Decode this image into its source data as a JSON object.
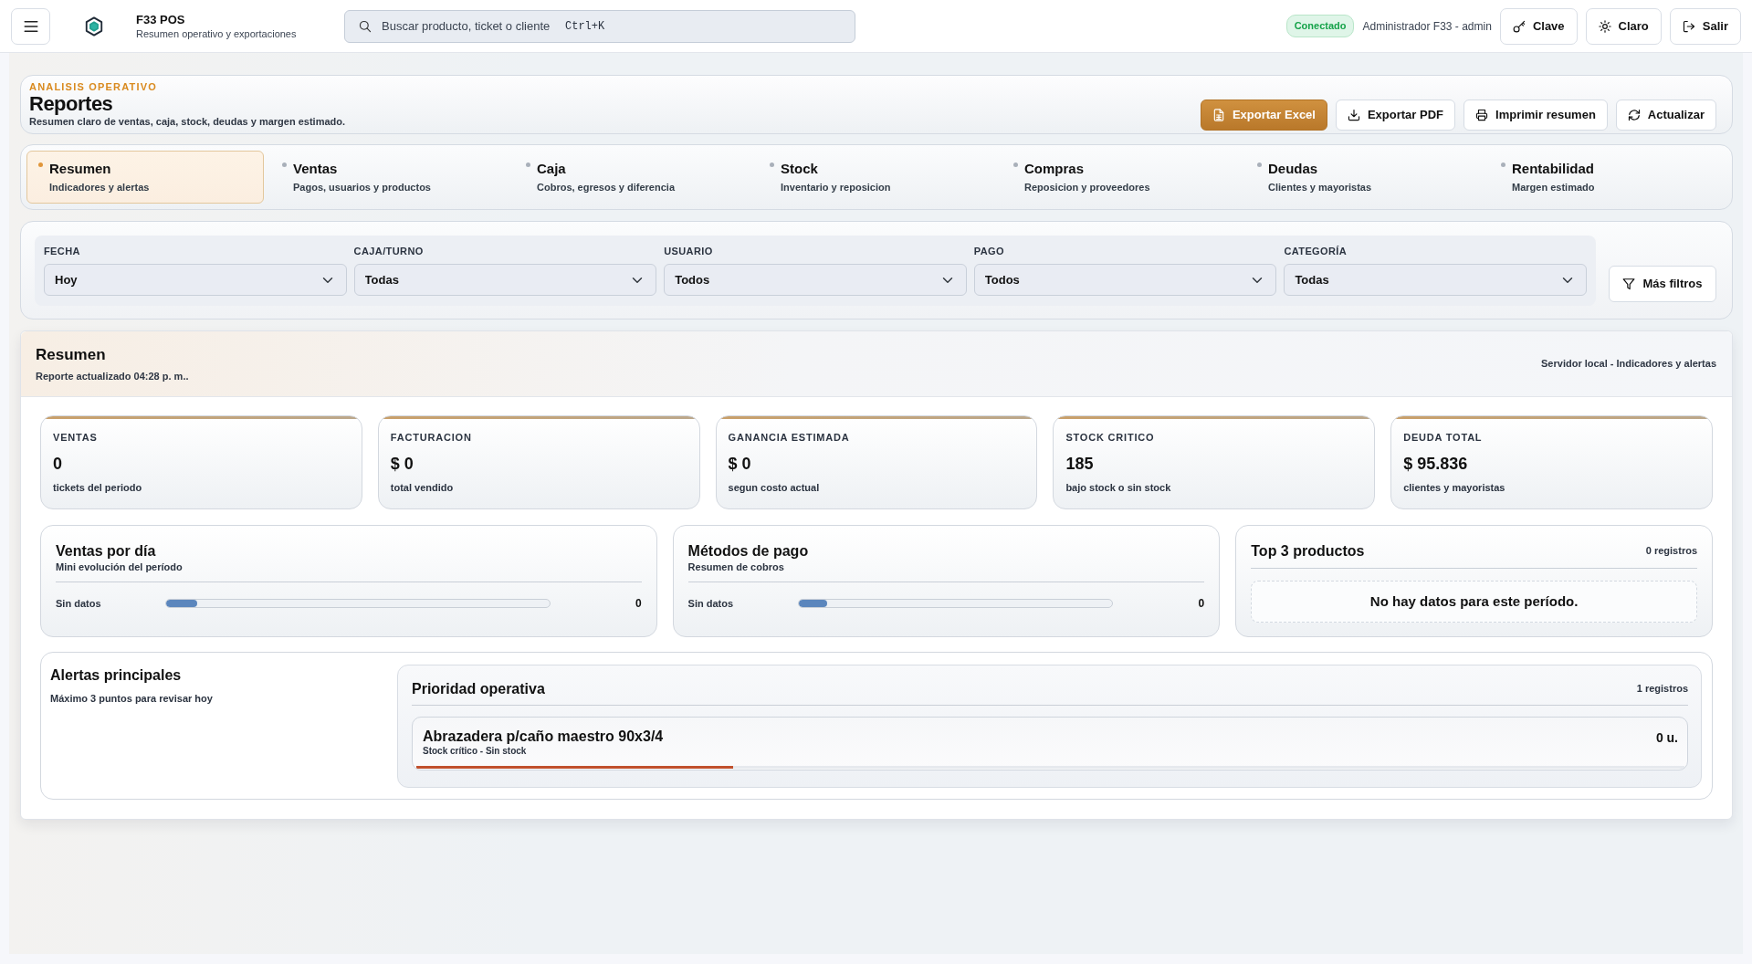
{
  "topbar": {
    "title": "F33 POS",
    "subtitle": "Resumen operativo y exportaciones",
    "search": {
      "placeholder": "Buscar producto, ticket o cliente",
      "shortcut": "Ctrl+K"
    },
    "status": {
      "label": "Conectado",
      "online": true
    },
    "user": "Administrador F33 - admin",
    "buttons": [
      {
        "label": "Clave"
      },
      {
        "label": "Claro"
      },
      {
        "label": "Salir"
      }
    ]
  },
  "header": {
    "eyebrow": "ANALISIS OPERATIVO",
    "title": "Reportes",
    "subtitle": "Resumen claro de ventas, caja, stock, deudas y margen estimado.",
    "buttons": [
      {
        "label": "Exportar Excel",
        "primary": true
      },
      {
        "label": "Exportar PDF",
        "primary": false
      },
      {
        "label": "Imprimir resumen",
        "primary": false
      },
      {
        "label": "Actualizar",
        "primary": false
      }
    ]
  },
  "tabs": [
    {
      "label": "Resumen",
      "sublabel": "Indicadores y alertas",
      "selected": true
    },
    {
      "label": "Ventas",
      "sublabel": "Pagos, usuarios y productos",
      "selected": false
    },
    {
      "label": "Caja",
      "sublabel": "Cobros, egresos y diferencia",
      "selected": false
    },
    {
      "label": "Stock",
      "sublabel": "Inventario y reposicion",
      "selected": false
    },
    {
      "label": "Compras",
      "sublabel": "Reposicion y proveedores",
      "selected": false
    },
    {
      "label": "Deudas",
      "sublabel": "Clientes y mayoristas",
      "selected": false
    },
    {
      "label": "Rentabilidad",
      "sublabel": "Margen estimado",
      "selected": false
    }
  ],
  "filters": {
    "fields": [
      {
        "label": "FECHA",
        "value": "Hoy"
      },
      {
        "label": "CAJA/TURNO",
        "value": "Todas"
      },
      {
        "label": "USUARIO",
        "value": "Todos"
      },
      {
        "label": "PAGO",
        "value": "Todos"
      },
      {
        "label": "CATEGORÍA",
        "value": "Todas"
      }
    ],
    "more_button": "Más filtros"
  },
  "summary": {
    "title": "Resumen",
    "updated": "Reporte actualizado 04:28 p. m..",
    "source": "Servidor local - Indicadores y alertas",
    "kpis": [
      {
        "label": "VENTAS",
        "value": "0",
        "note": "tickets del periodo"
      },
      {
        "label": "FACTURACION",
        "value": "$ 0",
        "note": "total vendido"
      },
      {
        "label": "GANANCIA ESTIMADA",
        "value": "$ 0",
        "note": "segun costo actual"
      },
      {
        "label": "STOCK CRITICO",
        "value": "185",
        "note": "bajo stock o sin stock"
      },
      {
        "label": "DEUDA TOTAL",
        "value": "$ 95.836",
        "note": "clientes y mayoristas"
      }
    ],
    "panels": [
      {
        "kind": "bar",
        "title": "Ventas por día",
        "subtitle": "Mini evolución del período",
        "label": "Sin datos",
        "level": 0.08,
        "value": "0"
      },
      {
        "kind": "bar",
        "title": "Métodos de pago",
        "subtitle": "Resumen de cobros",
        "label": "Sin datos",
        "level": 0.09,
        "value": "0"
      },
      {
        "kind": "empty",
        "title": "Top 3 productos",
        "count": "0 registros",
        "message": "No hay datos para este período."
      }
    ],
    "alerts": {
      "title": "Alertas principales",
      "subtitle": "Máximo 3 puntos para revisar hoy",
      "priority": {
        "title": "Prioridad operativa",
        "count": "1 registros",
        "items": [
          {
            "name": "Abrazadera p/caño maestro 90x3/4",
            "detail": "Stock crítico - Sin stock",
            "quantity": "0 u.",
            "level": 0.25
          }
        ]
      }
    }
  }
}
